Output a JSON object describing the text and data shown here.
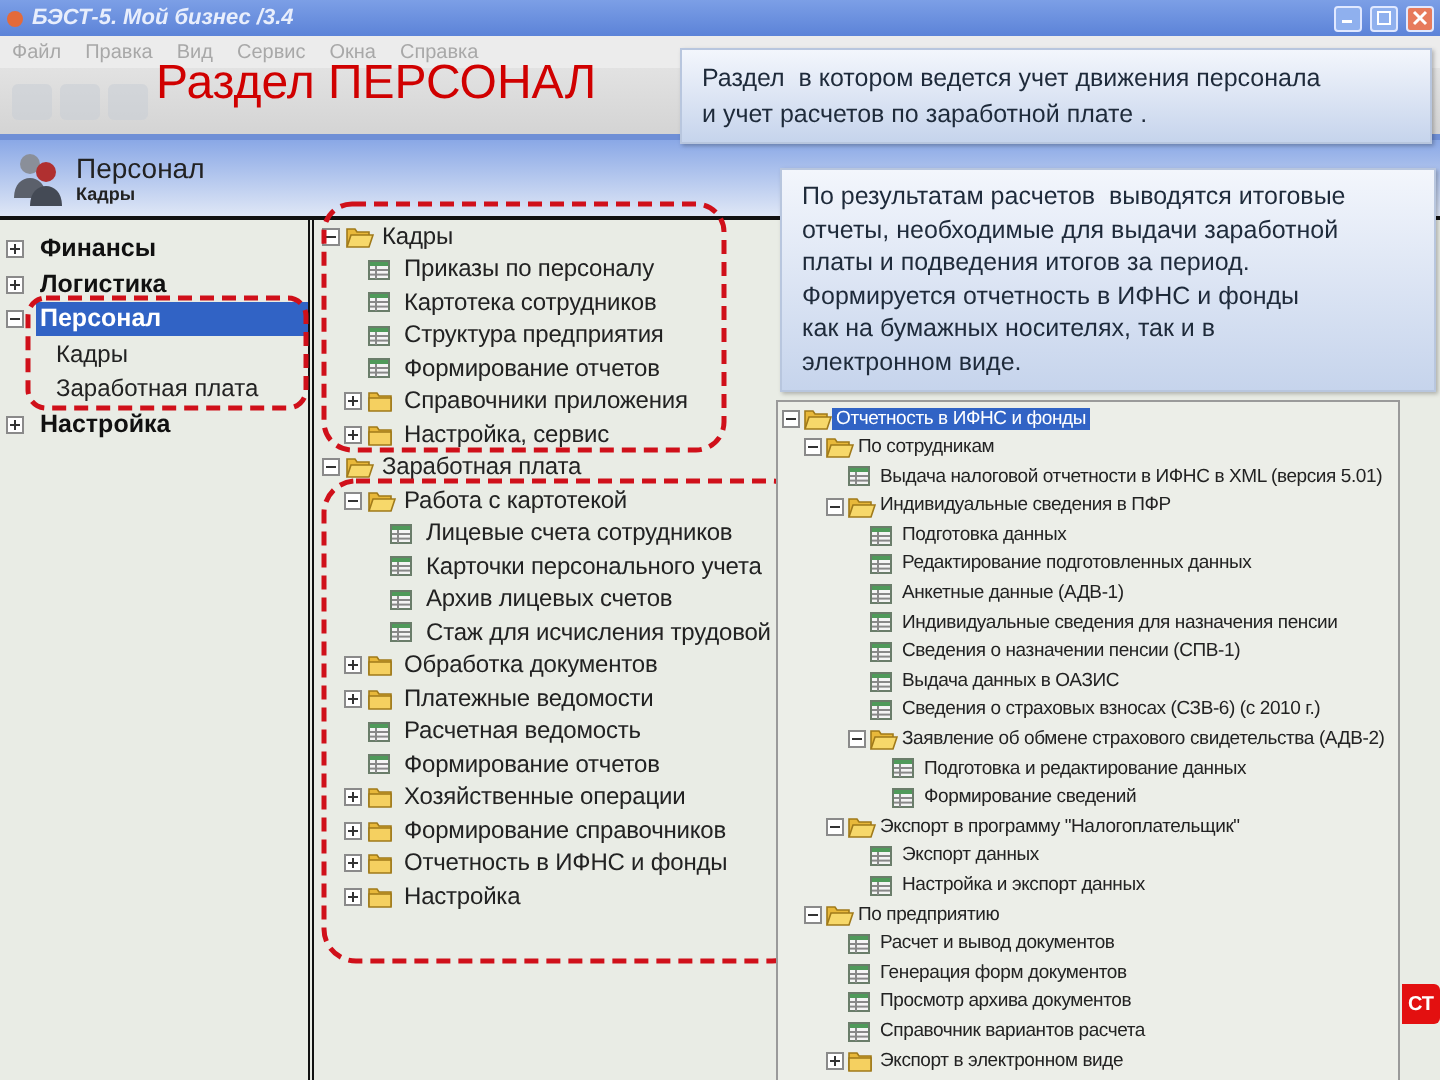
{
  "window": {
    "title": "БЭСТ-5. Мой бизнес /3.4"
  },
  "menu": [
    "Файл",
    "Правка",
    "Вид",
    "Сервис",
    "Окна",
    "Справка"
  ],
  "slide_title": "Раздел ПЕРСОНАЛ",
  "callouts": [
    {
      "text": "Раздел  в котором ведется учет движения персонала\nи учет расчетов по заработной плате ."
    },
    {
      "text": "По результатам расчетов  выводятся итоговые\nотчеты, необходимые для выдачи заработной\nплаты и подведения итогов за период.\nФормируется отчетность в ИФНС и фонды\nкак на бумажных носителях, так и в\nэлектронном виде."
    }
  ],
  "header": {
    "title": "Персонал",
    "subtitle": "Кадры"
  },
  "sidebar": {
    "items": [
      {
        "label": "Финансы",
        "expanded": false,
        "selected": false
      },
      {
        "label": "Логистика",
        "expanded": false,
        "selected": false
      },
      {
        "label": "Персонал",
        "expanded": true,
        "selected": true,
        "children": [
          {
            "label": "Кадры",
            "selected": false
          },
          {
            "label": "Заработная плата",
            "selected": false
          }
        ]
      },
      {
        "label": "Настройка",
        "expanded": false,
        "selected": false
      }
    ]
  },
  "main_tree": {
    "items": [
      {
        "label": "Кадры",
        "kind": "folder",
        "expanded": true,
        "children": [
          {
            "label": "Приказы по персоналу",
            "kind": "doc"
          },
          {
            "label": "Картотека сотрудников",
            "kind": "doc"
          },
          {
            "label": "Структура предприятия",
            "kind": "doc"
          },
          {
            "label": "Формирование отчетов",
            "kind": "doc"
          },
          {
            "label": "Справочники приложения",
            "kind": "folder",
            "expanded": false
          },
          {
            "label": "Настройка, сервис",
            "kind": "folder",
            "expanded": false
          }
        ]
      },
      {
        "label": "Заработная плата",
        "kind": "folder",
        "expanded": true,
        "children": [
          {
            "label": "Работа с картотекой",
            "kind": "folder",
            "expanded": true,
            "children": [
              {
                "label": "Лицевые счета сотрудников",
                "kind": "doc"
              },
              {
                "label": "Карточки персонального учета",
                "kind": "doc"
              },
              {
                "label": "Архив лицевых счетов",
                "kind": "doc"
              },
              {
                "label": "Стаж для исчисления трудовой",
                "kind": "doc"
              }
            ]
          },
          {
            "label": "Обработка документов",
            "kind": "folder",
            "expanded": false
          },
          {
            "label": "Платежные ведомости",
            "kind": "folder",
            "expanded": false
          },
          {
            "label": "Расчетная ведомость",
            "kind": "doc"
          },
          {
            "label": "Формирование отчетов",
            "kind": "doc"
          },
          {
            "label": "Хозяйственные операции",
            "kind": "folder",
            "expanded": false
          },
          {
            "label": "Формирование справочников",
            "kind": "folder",
            "expanded": false
          },
          {
            "label": "Отчетность в ИФНС и фонды",
            "kind": "folder",
            "expanded": false
          },
          {
            "label": "Настройка",
            "kind": "folder",
            "expanded": false
          }
        ]
      }
    ]
  },
  "inset_tree": {
    "items": [
      {
        "label": "Отчетность в ИФНС и фонды",
        "kind": "folder",
        "expanded": true,
        "selected": true,
        "children": [
          {
            "label": "По сотрудникам",
            "kind": "folder",
            "expanded": true,
            "selected": false,
            "children": [
              {
                "label": "Выдача налоговой отчетности в ИФНС в XML (версия 5.01)",
                "kind": "doc",
                "selected": false
              },
              {
                "label": "Индивидуальные сведения в ПФР",
                "kind": "folder",
                "expanded": true,
                "selected": false,
                "children": [
                  {
                    "label": "Подготовка данных",
                    "kind": "doc",
                    "selected": false
                  },
                  {
                    "label": "Редактирование подготовленных данных",
                    "kind": "doc",
                    "selected": false
                  },
                  {
                    "label": "Анкетные данные (АДВ-1)",
                    "kind": "doc",
                    "selected": false
                  },
                  {
                    "label": "Индивидуальные сведения для назначения пенсии",
                    "kind": "doc",
                    "selected": false
                  },
                  {
                    "label": "Сведения о назначении пенсии (СПВ-1)",
                    "kind": "doc",
                    "selected": false
                  },
                  {
                    "label": "Выдача данных в ОАЗИС",
                    "kind": "doc",
                    "selected": false
                  },
                  {
                    "label": "Сведения о страховых взносах (СЗВ-6) (с 2010 г.)",
                    "kind": "doc",
                    "selected": false
                  },
                  {
                    "label": "Заявление об обмене страхового свидетельства (АДВ-2)",
                    "kind": "folder",
                    "expanded": true,
                    "selected": false,
                    "children": [
                      {
                        "label": "Подготовка и редактирование данных",
                        "kind": "doc",
                        "selected": false
                      },
                      {
                        "label": "Формирование сведений",
                        "kind": "doc",
                        "selected": false
                      }
                    ]
                  }
                ]
              },
              {
                "label": "Экспорт в программу \"Налогоплательщик\"",
                "kind": "folder",
                "expanded": true,
                "selected": false,
                "children": [
                  {
                    "label": "Экспорт данных",
                    "kind": "doc",
                    "selected": false
                  },
                  {
                    "label": "Настройка и экспорт данных",
                    "kind": "doc",
                    "selected": false
                  }
                ]
              }
            ]
          },
          {
            "label": "По предприятию",
            "kind": "folder",
            "expanded": true,
            "selected": false,
            "children": [
              {
                "label": "Расчет и вывод документов",
                "kind": "doc",
                "selected": false
              },
              {
                "label": "Генерация форм документов",
                "kind": "doc",
                "selected": false
              },
              {
                "label": "Просмотр архива документов",
                "kind": "doc",
                "selected": false
              },
              {
                "label": "Справочник вариантов расчета",
                "kind": "doc",
                "selected": false
              },
              {
                "label": "Экспорт в электронном виде",
                "kind": "folder",
                "expanded": false,
                "selected": false
              }
            ]
          }
        ]
      }
    ]
  },
  "red_button": {
    "label": "СТ"
  }
}
